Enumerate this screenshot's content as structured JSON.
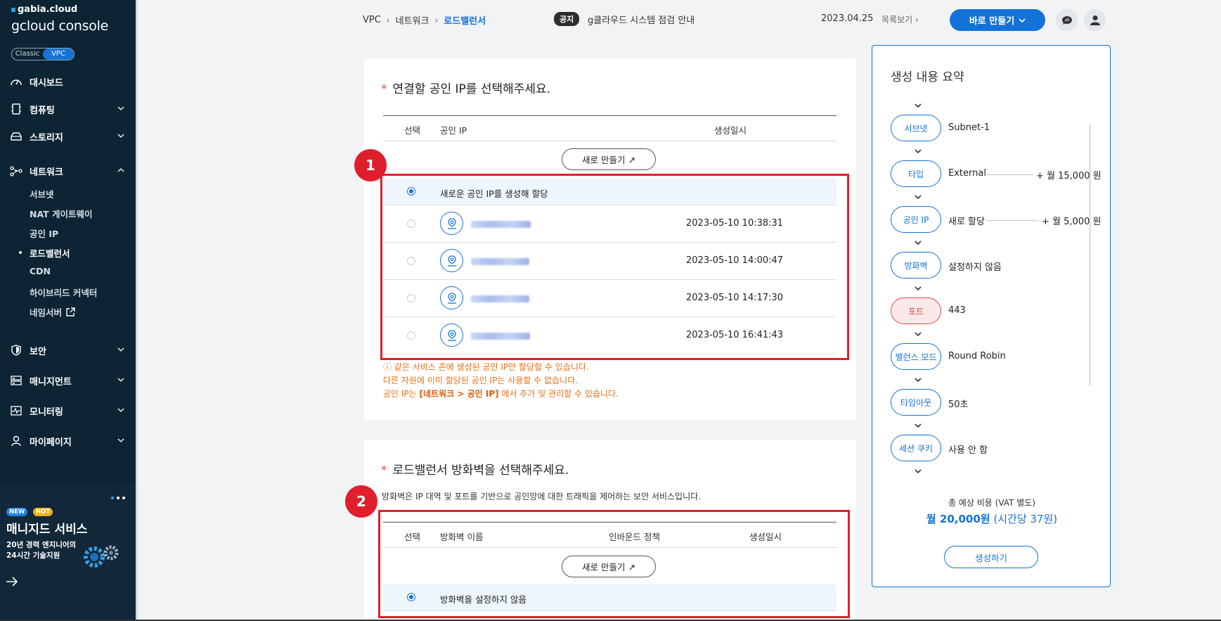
{
  "sidebar": {
    "logo_small": "gabia.cloud",
    "logo_big": "gcloud console",
    "switch": {
      "classic": "Classic",
      "vpc": "VPC"
    },
    "items": [
      {
        "label": "대시보드",
        "icon": "dashboard-icon"
      },
      {
        "label": "컴퓨팅",
        "icon": "server-icon"
      },
      {
        "label": "스토리지",
        "icon": "storage-icon"
      },
      {
        "label": "네트워크",
        "icon": "network-icon"
      },
      {
        "label": "보안",
        "icon": "shield-icon"
      },
      {
        "label": "매니지먼트",
        "icon": "management-icon"
      },
      {
        "label": "모니터링",
        "icon": "monitor-icon"
      },
      {
        "label": "마이페이지",
        "icon": "user-icon"
      }
    ],
    "network_sub": [
      "서브넷",
      "NAT 게이트웨이",
      "공인 IP",
      "로드밸런서",
      "CDN",
      "하이브리드 커넥터",
      "네임서버"
    ],
    "promo": {
      "badge_new": "NEW",
      "badge_hot": "HOT",
      "title": "매니지드 서비스",
      "line1": "20년 경력 엔지니어의",
      "line2": "24시간 기술지원"
    }
  },
  "topbar": {
    "breadcrumb": [
      "VPC",
      "네트워크",
      "로드밸런서"
    ],
    "notice_tag": "공지",
    "notice_text": "g클라우드 시스템 점검 안내",
    "notice_date": "2023.04.25",
    "notice_more": "목록보기",
    "quick_button": "바로 만들기"
  },
  "public_ip": {
    "title": "연결할 공인 IP를 선택해주세요.",
    "columns": [
      "선택",
      "공인 IP",
      "생성일시"
    ],
    "new_button": "새로 만들기 ↗",
    "new_option": "새로운 공인 IP를 생성해 할당",
    "rows": [
      {
        "created": "2023-05-10 10:38:31"
      },
      {
        "created": "2023-05-10 14:00:47"
      },
      {
        "created": "2023-05-10 14:17:30"
      },
      {
        "created": "2023-05-10 16:41:43"
      }
    ],
    "notes": {
      "line1": "ⓘ 같은 서비스 존에 생성된 공인 IP만 할당할 수 있습니다.",
      "line2": "다른 자원에 이미 할당된 공인 IP는 사용할 수 없습니다.",
      "line3_pre": "공인 IP는 ",
      "line3_bold": "[네트워크 > 공인 IP]",
      "line3_post": " 에서 추가 및 관리할 수 있습니다."
    },
    "marker": "1"
  },
  "firewall": {
    "title": "로드밸런서 방화벽을 선택해주세요.",
    "desc": "방화벽은 IP 대역 및 포트를 기반으로 공인망에 대한 트래픽을 제어하는 보안 서비스입니다.",
    "columns": [
      "선택",
      "방화벽 이름",
      "인바운드 정책",
      "생성일시"
    ],
    "new_button": "새로 만들기 ↗",
    "none_option": "방화벽을 설정하지 않음",
    "marker": "2"
  },
  "summary": {
    "title": "생성 내용 요약",
    "items": [
      {
        "tag": "서브넷",
        "value": "Subnet-1",
        "price": ""
      },
      {
        "tag": "타입",
        "value": "External",
        "price": "+ 월 15,000 원"
      },
      {
        "tag": "공인 IP",
        "value": "새로 할당",
        "price": "+ 월 5,000 원"
      },
      {
        "tag": "방화벽",
        "value": "설정하지 않음",
        "price": ""
      },
      {
        "tag": "포트",
        "value": "443",
        "price": ""
      },
      {
        "tag": "밸런스 모드",
        "value": "Round Robin",
        "price": ""
      },
      {
        "tag": "타임아웃",
        "value": "50초",
        "price": ""
      },
      {
        "tag": "세션 쿠키",
        "value": "사용 안 함",
        "price": ""
      }
    ],
    "total_label": "총 예상 비용 (VAT 별도)",
    "total_main": "월 20,000원",
    "total_hourly": " (시간당 37원)",
    "create_button": "생성하기"
  },
  "colors": {
    "accent": "#1372d8",
    "highlight": "#e01f2d",
    "sidebar": "#0c2434",
    "note": "#ea7015"
  }
}
